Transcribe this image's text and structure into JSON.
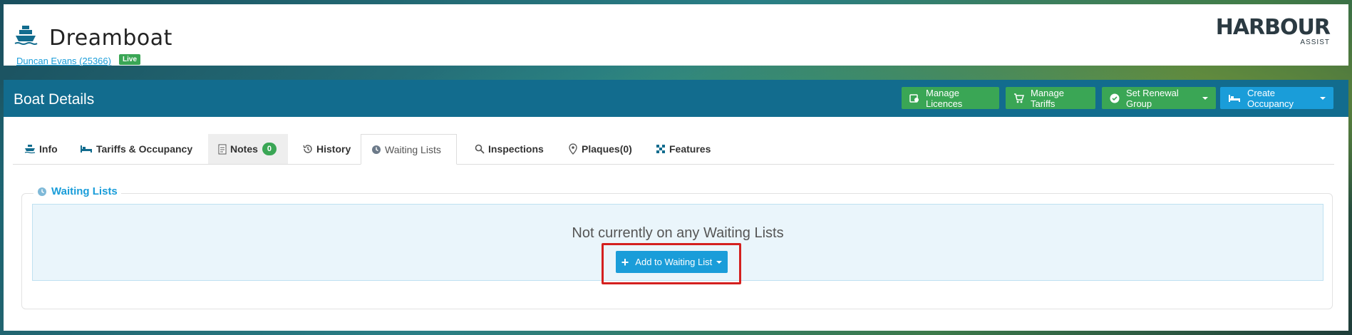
{
  "header": {
    "boat_name": "Dreamboat",
    "owner_link": "Duncan Evans (25366)",
    "status_badge": "Live",
    "logo_main": "HARBOUR",
    "logo_sub": "ASSIST"
  },
  "panel": {
    "title": "Boat Details",
    "actions": {
      "manage_licences": "Manage Licences",
      "manage_tariffs": "Manage Tariffs",
      "set_renewal_group": "Set Renewal Group",
      "create_occupancy": "Create Occupancy"
    }
  },
  "tabs": {
    "info": "Info",
    "tariffs_occupancy": "Tariffs & Occupancy",
    "notes": "Notes",
    "notes_count": "0",
    "history": "History",
    "waiting_lists": "Waiting Lists",
    "inspections": "Inspections",
    "plaques": "Plaques(0)",
    "features": "Features"
  },
  "waiting_lists": {
    "legend": "Waiting Lists",
    "empty_message": "Not currently on any Waiting Lists",
    "add_button": "Add to Waiting List"
  },
  "colors": {
    "brand_blue": "#126c8e",
    "accent_blue": "#1a9dd9",
    "green": "#3aa655",
    "highlight_red": "#d4201f"
  },
  "icons": {
    "boat": "boat-icon",
    "licence": "licence-icon",
    "cart": "cart-icon",
    "check": "check-circle-icon",
    "bed": "bed-icon",
    "note": "note-icon",
    "history": "history-icon",
    "clock": "clock-icon",
    "search": "search-icon",
    "pin": "map-pin-icon",
    "grid": "grid-icon",
    "plus": "plus-icon"
  }
}
